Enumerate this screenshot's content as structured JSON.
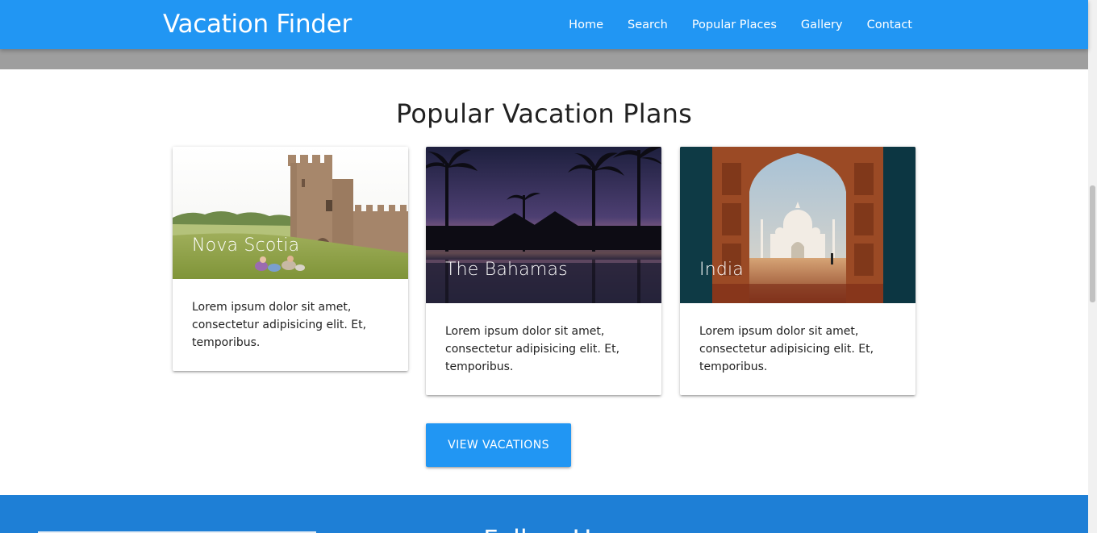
{
  "navbar": {
    "brand": "Vacation Finder",
    "links": [
      {
        "label": "Home"
      },
      {
        "label": "Search"
      },
      {
        "label": "Popular Places"
      },
      {
        "label": "Gallery"
      },
      {
        "label": "Contact"
      }
    ],
    "color": "#2196f3"
  },
  "section": {
    "title": "Popular Vacation Plans",
    "cards": [
      {
        "title": "Nova Scotia",
        "text": "Lorem ipsum dolor sit amet, consectetur adipisicing elit. Et, temporibus."
      },
      {
        "title": "The Bahamas",
        "text": "Lorem ipsum dolor sit amet, consectetur adipisicing elit. Et, temporibus."
      },
      {
        "title": "India",
        "text": "Lorem ipsum dolor sit amet, consectetur adipisicing elit. Et, temporibus."
      }
    ],
    "button_label": "VIEW VACATIONS"
  },
  "footer": {
    "heading": "Follow Us",
    "color": "#1e7fd6"
  }
}
